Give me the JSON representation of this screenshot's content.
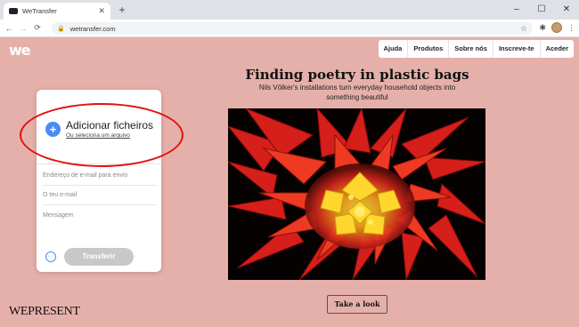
{
  "browser": {
    "tab_title": "WeTransfer",
    "tab_close": "✕",
    "new_tab": "+",
    "window_controls": [
      "–",
      "☐",
      "✕"
    ],
    "url": "wetransfer.com",
    "back": "←",
    "forward": "→",
    "reload": "C",
    "icons": [
      "lock-icon",
      "star-icon",
      "extensions-icon",
      "avatar",
      "menu-icon"
    ]
  },
  "site": {
    "logo": "we",
    "nav": [
      "Ajuda",
      "Produtos",
      "Sobre nós",
      "Inscreve-te",
      "Aceder"
    ]
  },
  "upload": {
    "add_title": "Adicionar ficheiros",
    "add_subtitle": "Ou seleciona um arquivo",
    "plus_symbol": "+",
    "more_symbol": "···",
    "email_to_placeholder": "Endereço de e-mail para envio",
    "your_email_placeholder": "O teu e-mail",
    "message_placeholder": "Mensagem",
    "transfer_button": "Transferir"
  },
  "feature": {
    "headline": "Finding poetry in plastic bags",
    "subline": "Nils Völker's installations turn everyday household objects into something beautiful",
    "cta": "Take a look",
    "brand": "WEPRESENT"
  },
  "colors": {
    "page_bg": "#e6b0aa",
    "accent_blue": "#4a8bf5",
    "annotation_red": "#e21010"
  }
}
